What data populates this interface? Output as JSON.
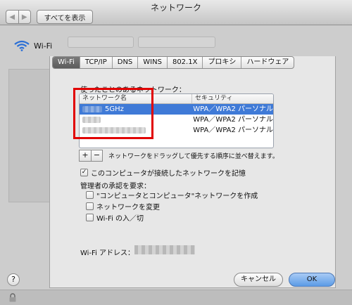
{
  "window": {
    "title": "ネットワーク",
    "nav_back": "◀",
    "nav_forward": "▶",
    "show_all": "すべてを表示"
  },
  "interface": {
    "name": "Wi-Fi",
    "icon": "wifi-icon"
  },
  "tabs": [
    {
      "label": "Wi-Fi",
      "active": true
    },
    {
      "label": "TCP/IP",
      "active": false
    },
    {
      "label": "DNS",
      "active": false
    },
    {
      "label": "WINS",
      "active": false
    },
    {
      "label": "802.1X",
      "active": false
    },
    {
      "label": "プロキシ",
      "active": false
    },
    {
      "label": "ハードウェア",
      "active": false
    }
  ],
  "networks": {
    "section_label": "使ったことのあるネットワーク：",
    "columns": [
      "ネットワーク名",
      "セキュリティ"
    ],
    "rows": [
      {
        "name": "5GHz",
        "security": "WPA／WPA2 パーソナル",
        "selected": true
      },
      {
        "name": "",
        "security": "WPA／WPA2 パーソナル",
        "selected": false
      },
      {
        "name": "",
        "security": "WPA／WPA2 パーソナル",
        "selected": false
      }
    ],
    "add_label": "+",
    "remove_label": "−",
    "drag_hint": "ネットワークをドラッグして優先する順序に並べ替えます。"
  },
  "options": {
    "remember_label": "このコンピュータが接続したネットワークを記憶",
    "remember_checked": true,
    "admin_heading": "管理者の承認を要求：",
    "admin_items": [
      {
        "label": "\"コンピュータとコンピュータ\"ネットワークを作成",
        "checked": false
      },
      {
        "label": "ネットワークを変更",
        "checked": false
      },
      {
        "label": "Wi-Fi の入／切",
        "checked": false
      }
    ]
  },
  "address": {
    "label": "Wi-Fi アドレス："
  },
  "buttons": {
    "help": "?",
    "cancel": "キャンセル",
    "ok": "OK"
  },
  "colors": {
    "selection": "#3f7ad7",
    "highlight": "#e10000"
  }
}
